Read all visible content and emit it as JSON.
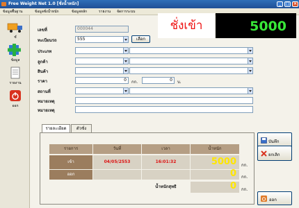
{
  "window": {
    "title": "Free Weight Net 1.0 [ชั่งน้ำหนัก]"
  },
  "menu": [
    "ข้อมูลพื้นฐาน",
    "ข้อมูลชั่งน้ำหนัก",
    "ข้อมูลหลัก",
    "รายงาน",
    "จัดการระบบ"
  ],
  "sidebar": [
    {
      "label": "ชั่"
    },
    {
      "label": "ข้อมูล"
    },
    {
      "label": "รายงาน"
    },
    {
      "label": "ออก"
    }
  ],
  "form": {
    "doc_no_label": "เลขที่",
    "doc_no_value": "000044",
    "plate_label": "ทะเบียนรถ",
    "plate_value": "555",
    "select_button": "เลือก",
    "type_label": "ประเภท",
    "customer_label": "ลูกค้า",
    "product_label": "สินค้า",
    "price_label": "ราคา",
    "price_value": "0",
    "price_unit": "กก.",
    "price_value2": "0",
    "price_unit2": "บ.",
    "location_label": "สถานที่",
    "note1_label": "หมายเหตุ",
    "note2_label": "หมายเหตุ"
  },
  "weigh": {
    "heading": "ชั่งเข้า",
    "display": "5000"
  },
  "tabs": [
    "รายละเอียด",
    "ตัวชั่ง"
  ],
  "table": {
    "headers": [
      "รายการ",
      "วันที่",
      "เวลา",
      "น้ำหนัก"
    ],
    "rows": [
      {
        "item": "เข้า",
        "date": "04/05/2553",
        "time": "16:01:32",
        "weight": "5000",
        "unit": "กก."
      },
      {
        "item": "ออก",
        "date": "",
        "time": "",
        "weight": "0",
        "unit": "กก."
      }
    ],
    "net_label": "น้ำหนักสุทธิ",
    "net_value": "0",
    "net_unit": "กก."
  },
  "actions": {
    "save": "บันทึก",
    "cancel": "ยกเลิก",
    "exit": "ออก"
  },
  "colors": {
    "display_bg": "#000000",
    "display_fg": "#38e838",
    "heading": "#e11111",
    "date_red": "#dd1111",
    "weight_yellow": "#ffe600",
    "table_header": "#b59e84",
    "row_bg": "#9b7d5e"
  }
}
